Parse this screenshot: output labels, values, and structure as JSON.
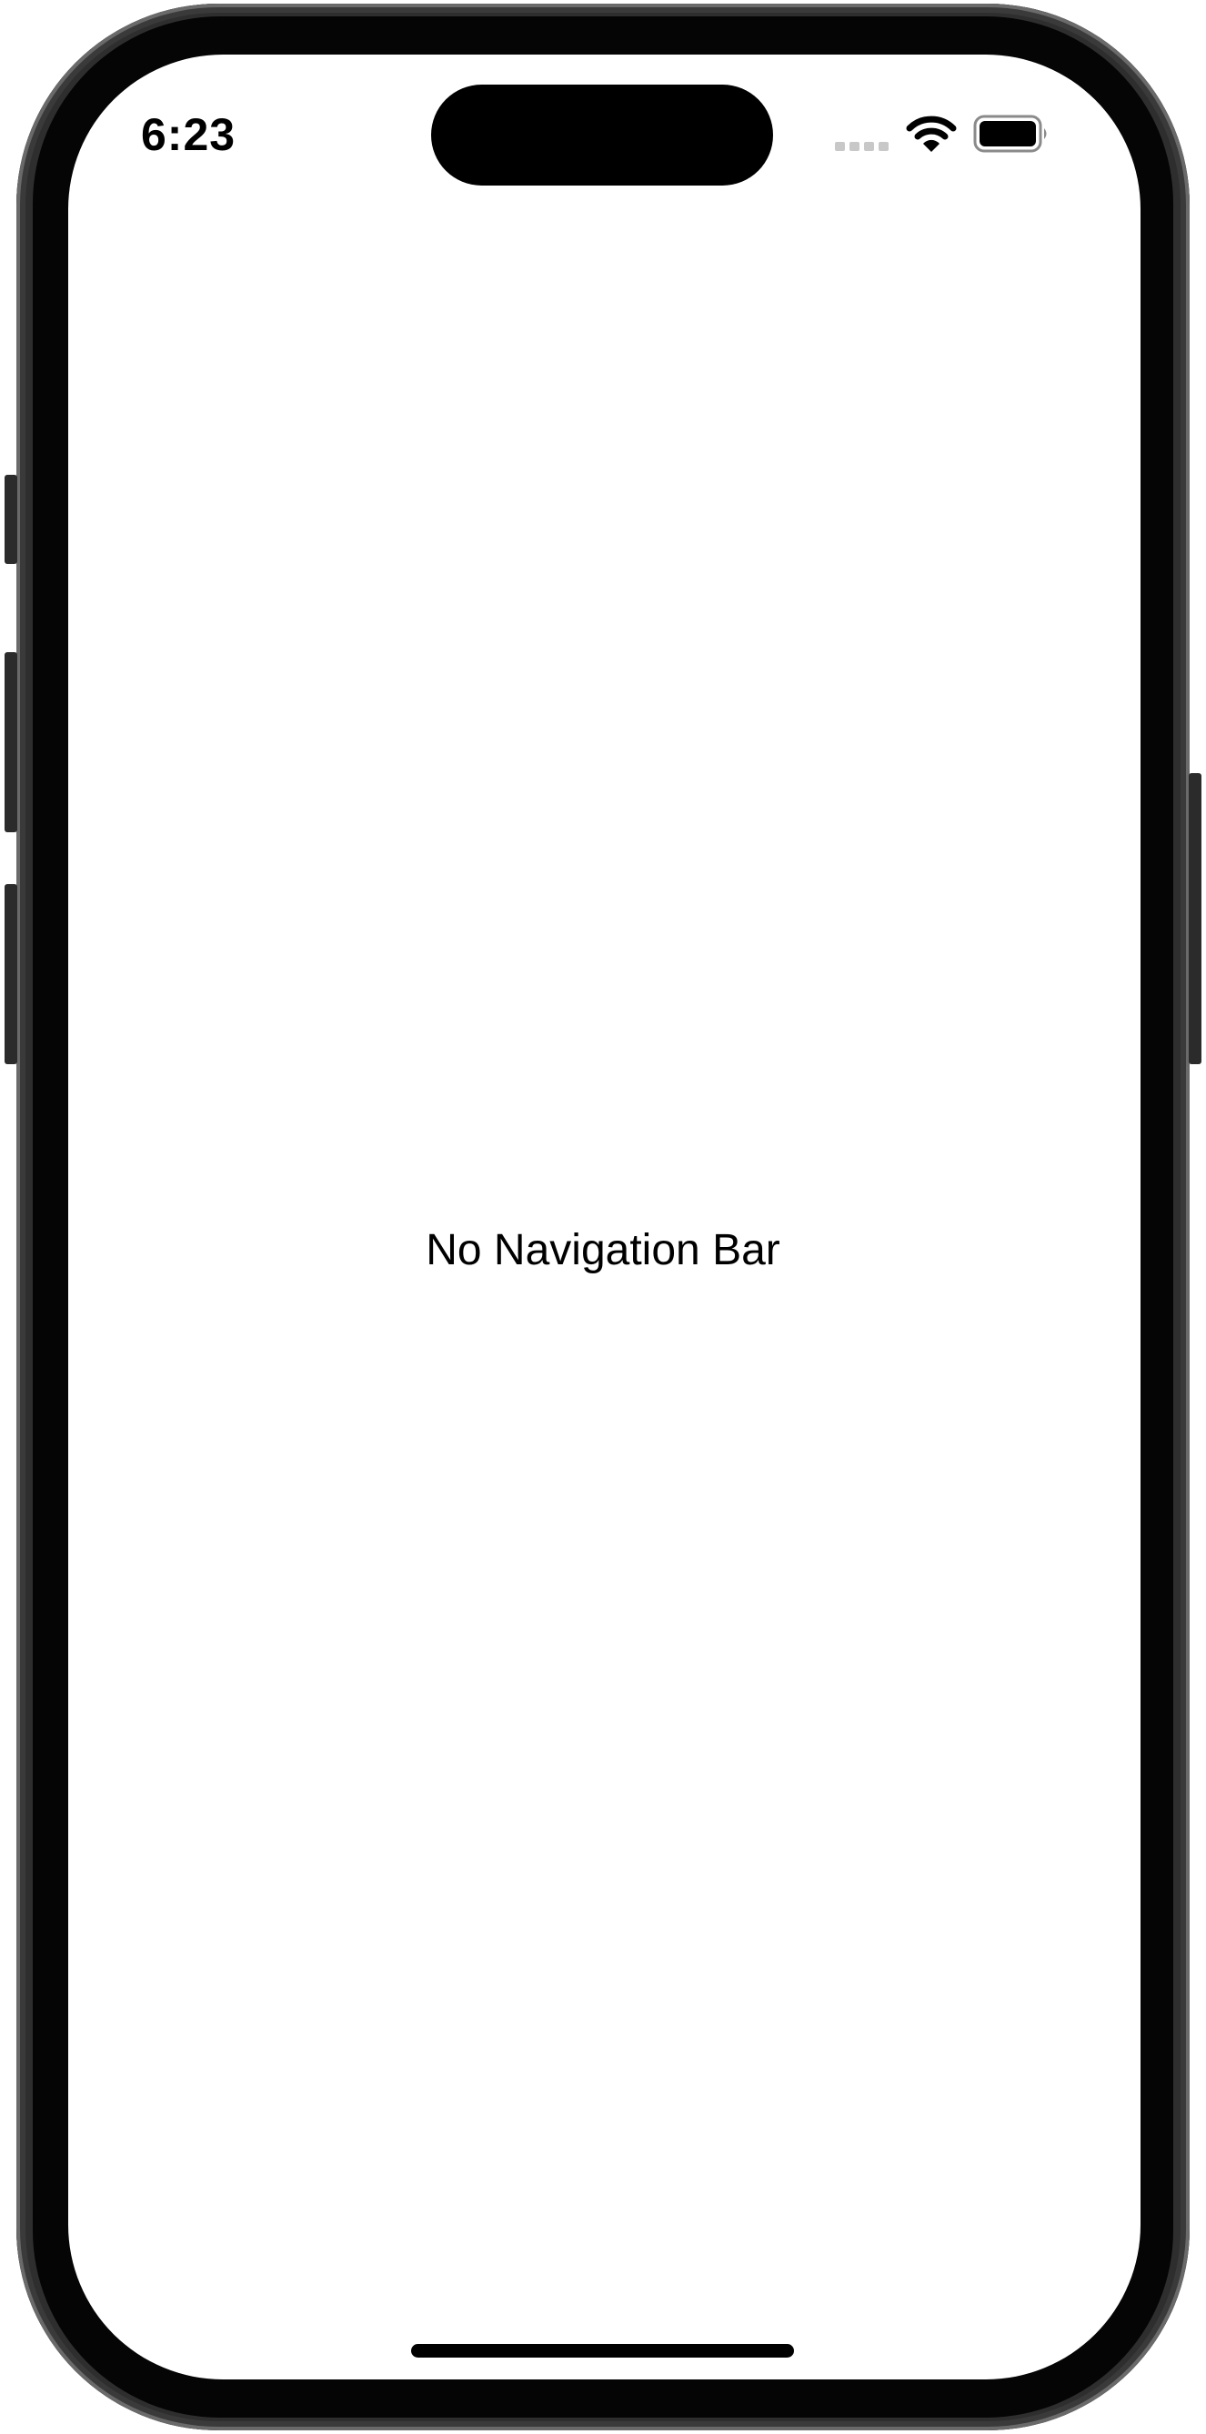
{
  "status_bar": {
    "time": "6:23",
    "signal_icon": "cellular-signal-icon",
    "wifi_icon": "wifi-icon",
    "battery_icon": "battery-icon",
    "battery_level": 1.0
  },
  "content": {
    "message": "No Navigation Bar"
  },
  "colors": {
    "background": "#ffffff",
    "text": "#000000",
    "frame": "#2e2e2e",
    "bezel": "#050505",
    "signal_inactive": "#c8c8c8"
  }
}
